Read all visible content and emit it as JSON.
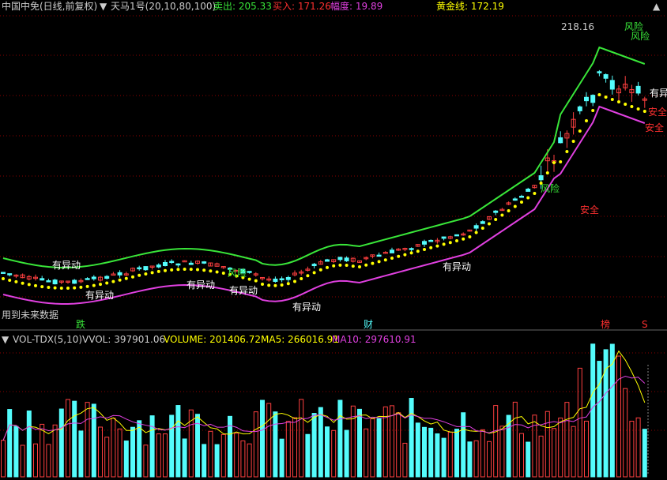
{
  "header": {
    "stock_title": "中国中免(日线,前复权)",
    "indicator_title": "天马1号(20,10,80,100)",
    "sell_label": "卖出: 205.33",
    "buy_label": "买入: 171.26",
    "range_label": "幅度: 19.89",
    "golden_label": "黄金线: 172.19",
    "future_data_note": "用到未来数据"
  },
  "volume_header": {
    "title": "VOL-TDX(5,10)",
    "vvol_label": "VVOL: 397901.06",
    "volume_label": "VOLUME: 201406.72",
    "ma5_label": "MA5: 266016.91",
    "ma10_label": "MA10: 297610.91"
  },
  "colors": {
    "background": "#000000",
    "up_candle": "#ff4040",
    "down_candle": "#54fcfc",
    "upper_band": "#39e639",
    "lower_band": "#e040e0",
    "golden_dots": "#ffff00",
    "signal_risk": "#39e639",
    "signal_safe": "#ff3030",
    "signal_move": "#ffffff",
    "ma5": "#ffff00",
    "ma10": "#e040e0",
    "header_white": "#cccccc",
    "header_green": "#39e639",
    "header_red": "#ff3030",
    "header_magenta": "#e040e0",
    "header_yellow": "#ffff00"
  },
  "chart_data": [
    {
      "type": "candlestick",
      "title": "中国中免(日线,前复权)",
      "indicator": "天马1号(20,10,80,100)",
      "ylim": [
        150,
        225
      ],
      "annotations": {
        "max_price": "218.16",
        "risk_label": "风险",
        "safe_label": "安全",
        "unusual_label": "有异动",
        "bottom_markers": [
          "跌",
          "财",
          "榜",
          "S"
        ]
      },
      "candles_count": 100
    },
    {
      "type": "bar",
      "title": "VOL-TDX(5,10)",
      "series": [
        {
          "name": "VOLUME",
          "last": 201406.72
        },
        {
          "name": "MA5",
          "last": 266016.91
        },
        {
          "name": "MA10",
          "last": 297610.91
        }
      ]
    }
  ]
}
